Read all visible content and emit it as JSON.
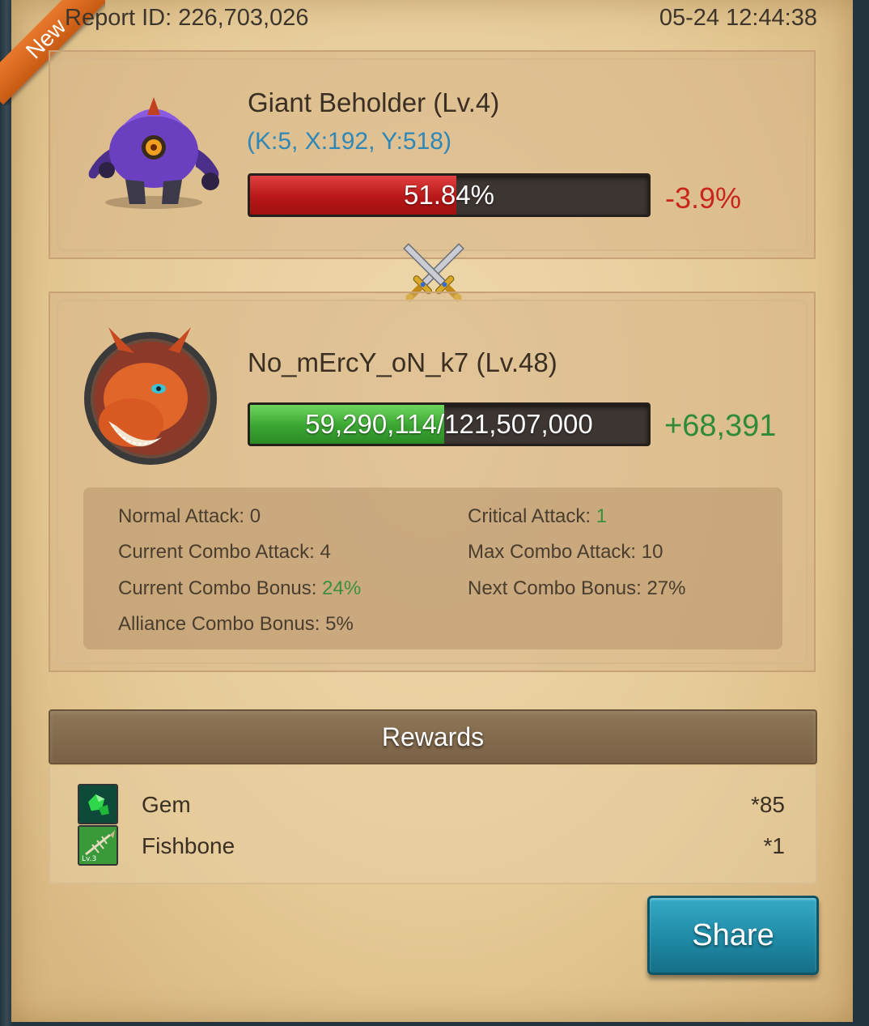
{
  "ribbon": {
    "label": "New"
  },
  "report": {
    "id_text": "Report ID: 226,703,026",
    "timestamp": "05-24 12:44:38"
  },
  "monster": {
    "name": "Giant Beholder (Lv.4)",
    "coords": "(K:5, X:192, Y:518)",
    "health_text": "51.84%",
    "health_fraction": 0.5184,
    "delta": "-3.9%",
    "portrait_icon": "giant-beholder-portrait"
  },
  "player": {
    "name": "No_mErcY_oN_k7 (Lv.48)",
    "power_text": "59,290,114/121,507,000",
    "power_fraction": 0.488,
    "delta": "+68,391",
    "portrait_icon": "dragon-avatar"
  },
  "stats": {
    "normal_attack_label": "Normal Attack: ",
    "normal_attack_value": "0",
    "critical_attack_label": "Critical Attack: ",
    "critical_attack_value": "1",
    "current_combo_attack_label": "Current Combo Attack: ",
    "current_combo_attack_value": "4",
    "max_combo_attack_label": "Max Combo Attack: ",
    "max_combo_attack_value": "10",
    "current_combo_bonus_label": "Current Combo Bonus: ",
    "current_combo_bonus_value": "24%",
    "next_combo_bonus_label": "Next Combo Bonus: ",
    "next_combo_bonus_value": "27%",
    "alliance_combo_bonus_label": "Alliance Combo Bonus: ",
    "alliance_combo_bonus_value": "5%"
  },
  "rewards": {
    "title": "Rewards",
    "items": [
      {
        "name": "Gem",
        "qty": "*85",
        "icon": "gem-icon"
      },
      {
        "name": "Fishbone",
        "qty": "*1",
        "icon": "fishbone-icon",
        "level_tag": "Lv.3"
      }
    ]
  },
  "share": {
    "label": "Share"
  },
  "colors": {
    "monster_bar": "#c81e1e",
    "player_bar": "#3aa532",
    "delta_negative": "#c8261c",
    "delta_positive": "#2f8b3a",
    "coords": "#2e87b7",
    "share_button": "#1f8aa6"
  }
}
